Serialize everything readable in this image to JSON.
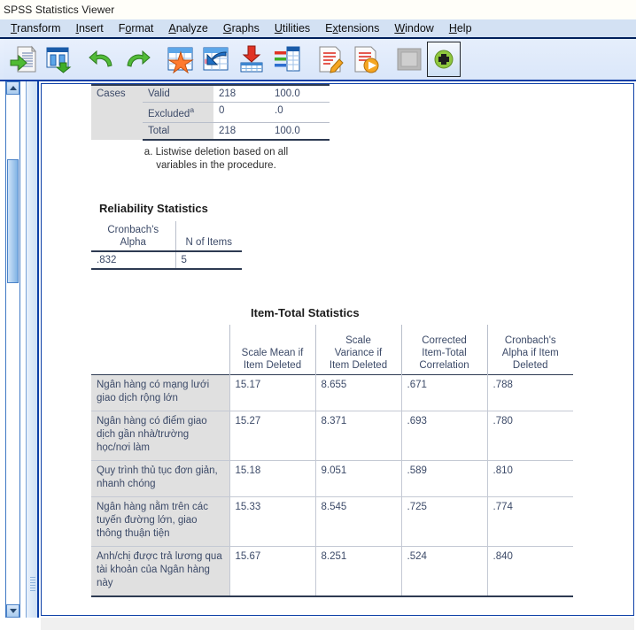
{
  "window": {
    "title": "SPSS Statistics Viewer"
  },
  "menubar": {
    "items": [
      {
        "name": "transform",
        "pre": "T",
        "post": "ransform"
      },
      {
        "name": "insert",
        "pre": "I",
        "post": "nsert"
      },
      {
        "name": "format",
        "pre": "F",
        "mid": "o",
        "post": "rmat",
        "split": true
      },
      {
        "name": "analyze",
        "pre": "A",
        "post": "nalyze"
      },
      {
        "name": "graphs",
        "pre": "G",
        "post": "raphs"
      },
      {
        "name": "utilities",
        "pre": "U",
        "post": "tilities"
      },
      {
        "name": "extensions",
        "pre": "E",
        "mid": "x",
        "post": "tensions",
        "split": true
      },
      {
        "name": "window",
        "pre": "W",
        "post": "indow"
      },
      {
        "name": "help",
        "pre": "H",
        "post": "elp"
      }
    ],
    "labels": {
      "transform": "Transform",
      "insert": "Insert",
      "format": "Format",
      "analyze": "Analyze",
      "graphs": "Graphs",
      "utilities": "Utilities",
      "extensions": "Extensions",
      "window": "Window",
      "help": "Help"
    }
  },
  "toolbar": {
    "buttons": [
      {
        "name": "open-file-icon",
        "label": "Open"
      },
      {
        "name": "export-window-icon",
        "label": "Export"
      },
      {
        "name": "undo-icon",
        "label": "Undo"
      },
      {
        "name": "redo-icon",
        "label": "Redo"
      },
      {
        "name": "goto-favorite-icon",
        "label": "Go to favorite"
      },
      {
        "name": "goto-data-icon",
        "label": "Go to data"
      },
      {
        "name": "export-output-icon",
        "label": "Export output"
      },
      {
        "name": "variables-icon",
        "label": "Variables"
      },
      {
        "name": "edit-syntax-icon",
        "label": "Edit syntax"
      },
      {
        "name": "run-syntax-icon",
        "label": "Run syntax"
      },
      {
        "name": "disabled-icon",
        "label": "Disabled"
      },
      {
        "name": "add-item-icon",
        "label": "Add"
      }
    ]
  },
  "output": {
    "case_processing": {
      "row_group_label": "Cases",
      "rows": [
        {
          "label": "Valid",
          "sup": "",
          "n": "218",
          "percent": "100.0"
        },
        {
          "label": "Excluded",
          "sup": "a",
          "n": "0",
          "percent": ".0"
        },
        {
          "label": "Total",
          "sup": "",
          "n": "218",
          "percent": "100.0"
        }
      ],
      "footnote_line1": "a. Listwise deletion based on all",
      "footnote_line2": "variables in the procedure."
    },
    "reliability": {
      "title": "Reliability Statistics",
      "headers": [
        {
          "line1": "Cronbach's",
          "line2": "Alpha"
        },
        {
          "line1": "",
          "line2": "N of Items"
        }
      ],
      "values": {
        "alpha": ".832",
        "n_items": "5"
      }
    },
    "item_total": {
      "title": "Item-Total Statistics",
      "headers": [
        {
          "line1": "",
          "line2": "",
          "line3": ""
        },
        {
          "line1": "",
          "line2": "Scale Mean if",
          "line3": "Item Deleted"
        },
        {
          "line1": "Scale",
          "line2": "Variance if",
          "line3": "Item Deleted"
        },
        {
          "line1": "Corrected",
          "line2": "Item-Total",
          "line3": "Correlation"
        },
        {
          "line1": "Cronbach's",
          "line2": "Alpha if Item",
          "line3": "Deleted"
        }
      ],
      "rows": [
        {
          "item": "Ngân hàng có mạng lưới giao dịch rộng lớn",
          "scale_mean": "15.17",
          "scale_variance": "8.655",
          "corrected_corr": ".671",
          "alpha_if_deleted": ".788"
        },
        {
          "item": "Ngân hàng có điểm giao dịch gần nhà/trường học/nơi làm",
          "scale_mean": "15.27",
          "scale_variance": "8.371",
          "corrected_corr": ".693",
          "alpha_if_deleted": ".780"
        },
        {
          "item": "Quy trình thủ tục đơn giản, nhanh chóng",
          "scale_mean": "15.18",
          "scale_variance": "9.051",
          "corrected_corr": ".589",
          "alpha_if_deleted": ".810"
        },
        {
          "item": "Ngân hàng nằm trên các tuyến đường lớn, giao thông thuận tiện",
          "scale_mean": "15.33",
          "scale_variance": "8.545",
          "corrected_corr": ".725",
          "alpha_if_deleted": ".774"
        },
        {
          "item": "Anh/chị được trả lương qua tài khoản của Ngân hàng này",
          "scale_mean": "15.67",
          "scale_variance": "8.251",
          "corrected_corr": ".524",
          "alpha_if_deleted": ".840"
        }
      ]
    }
  },
  "colors": {
    "menubar_bg": "#d3e1f3",
    "toolbar_bg": "#e3ecfb",
    "table_text": "#3c4a68",
    "header_shade": "#e0e0e0",
    "rule": "#2d3a52",
    "pane_border": "#0c3fa6"
  }
}
